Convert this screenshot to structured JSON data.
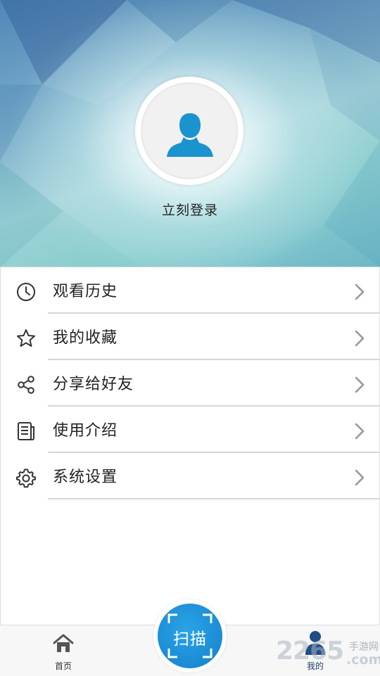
{
  "header": {
    "login_label": "立刻登录"
  },
  "menu": {
    "items": [
      {
        "label": "观看历史",
        "icon": "clock-icon"
      },
      {
        "label": "我的收藏",
        "icon": "star-icon"
      },
      {
        "label": "分享给好友",
        "icon": "share-icon"
      },
      {
        "label": "使用介绍",
        "icon": "document-icon"
      },
      {
        "label": "系统设置",
        "icon": "gear-icon"
      }
    ]
  },
  "tabbar": {
    "home_label": "首页",
    "scan_label": "扫描",
    "mine_label": "我的"
  },
  "watermark": {
    "number": "2265",
    "side_text": "手游网",
    "domain": ".com"
  },
  "colors": {
    "accent_blue": "#1b8bd4",
    "avatar_blue": "#1a93cf",
    "header_top": "#4f86b8",
    "header_teal": "#8dcfd0"
  }
}
